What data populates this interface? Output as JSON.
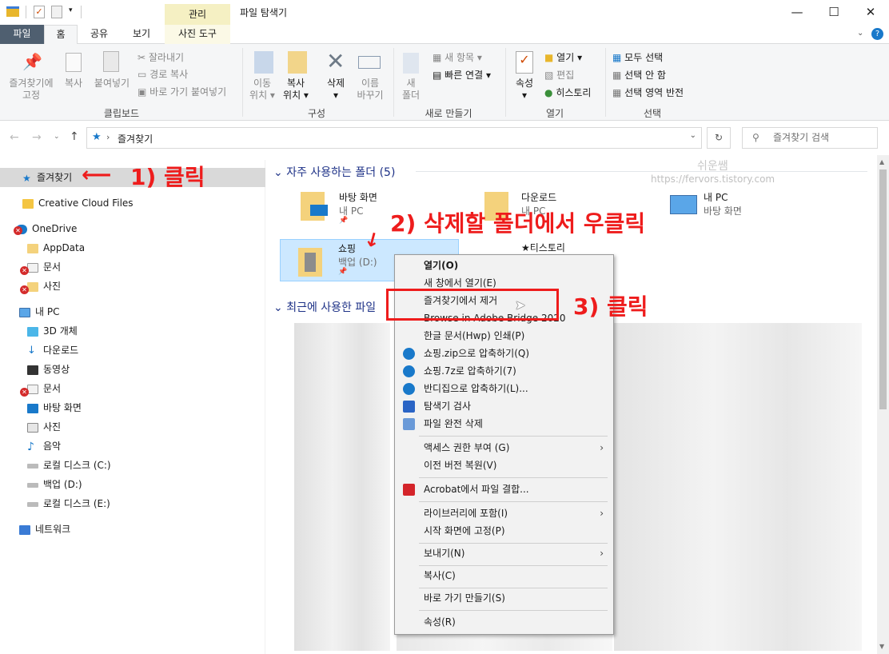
{
  "window": {
    "title": "파일 탐색기",
    "context_tab": "관리",
    "minimize": "—",
    "maximize": "☐",
    "close": "✕"
  },
  "tabs": {
    "file": "파일",
    "home": "홈",
    "share": "공유",
    "view": "보기",
    "picture_tools": "사진 도구"
  },
  "ribbon": {
    "pin": "즐겨찾기에",
    "pin2": "고정",
    "copy": "복사",
    "paste": "붙여넣기",
    "cut": "잘라내기",
    "copy_path": "경로 복사",
    "paste_shortcut": "바로 가기 붙여넣기",
    "clipboard": "클립보드",
    "move_to": "이동",
    "move_to2": "위치",
    "copy_to": "복사",
    "copy_to2": "위치",
    "delete": "삭제",
    "rename": "이름",
    "rename2": "바꾸기",
    "organize": "구성",
    "new_folder": "새",
    "new_folder2": "폴더",
    "new_item": "새 항목",
    "easy_access": "빠른 연결",
    "new": "새로 만들기",
    "properties": "속성",
    "open": "열기",
    "edit": "편집",
    "history": "히스토리",
    "open_group": "열기",
    "select_all": "모두 선택",
    "select_none": "선택 안 함",
    "invert": "선택 영역 반전",
    "select": "선택"
  },
  "address": {
    "path": "즐겨찾기",
    "search_placeholder": "즐겨찾기 검색"
  },
  "nav": {
    "items": [
      "즐겨찾기",
      "Creative Cloud Files",
      "OneDrive",
      "AppData",
      "문서",
      "사진",
      "내 PC",
      "3D 개체",
      "다운로드",
      "동영상",
      "문서",
      "바탕 화면",
      "사진",
      "음악",
      "로컬 디스크 (C:)",
      "백업 (D:)",
      "로컬 디스크 (E:)",
      "네트워크"
    ]
  },
  "content": {
    "frequent_header": "자주 사용하는 폴더 (5)",
    "recent_header": "최근에 사용한 파일",
    "folders": [
      {
        "name": "바탕 화면",
        "sub": "내 PC"
      },
      {
        "name": "다운로드",
        "sub": "내 PC"
      },
      {
        "name": "내 PC",
        "sub": "바탕 화면"
      },
      {
        "name": "쇼핑",
        "sub": "백업 (D:)"
      },
      {
        "name": "★티스토리",
        "sub": ""
      }
    ],
    "watermark": "쉬운쌤",
    "watermark_url": "https://fervors.tistory.com"
  },
  "context_menu": {
    "items": [
      "열기(O)",
      "새 창에서 열기(E)",
      "즐겨찾기에서 제거",
      "Browse in Adobe Bridge 2020",
      "한글 문서(Hwp) 인쇄(P)",
      "쇼핑.zip으로 압축하기(Q)",
      "쇼핑.7z로 압축하기(7)",
      "반디집으로 압축하기(L)...",
      "탐색기 검사",
      "파일 완전 삭제",
      "액세스 권한 부여 (G)",
      "이전 버전 복원(V)",
      "Acrobat에서 파일 결합...",
      "라이브러리에 포함(I)",
      "시작 화면에 고정(P)",
      "보내기(N)",
      "복사(C)",
      "바로 가기 만들기(S)",
      "속성(R)"
    ]
  },
  "annotations": {
    "step1": "1) 클릭",
    "step2": "2) 삭제할 폴더에서 우클릭",
    "step3": "3) 클릭"
  },
  "colors": {
    "accent": "#0063b1",
    "annot": "#ee1c1c",
    "file_tab": "#4f5f70"
  }
}
